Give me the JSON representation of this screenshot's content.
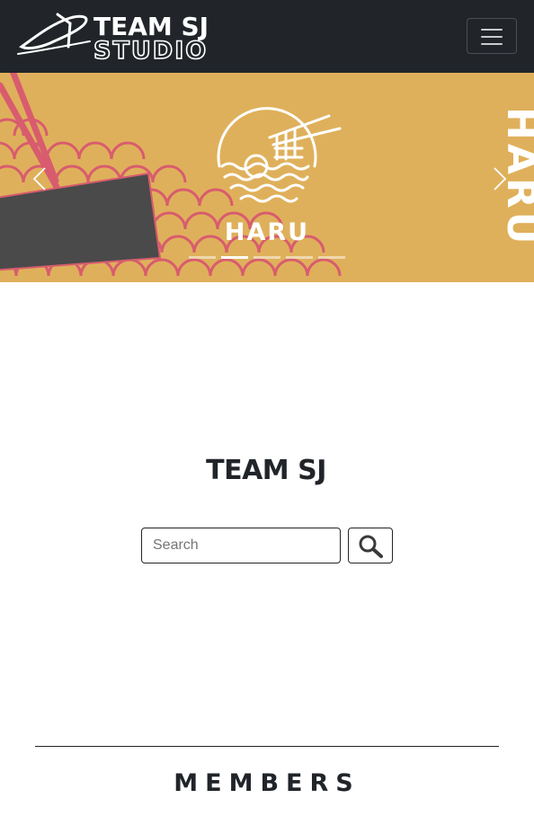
{
  "navbar": {
    "brand_line1": "TEAM SJ",
    "brand_line2": "STUDIO",
    "brand_color": "#ffffff",
    "background": "#212529",
    "menu_icon": "hamburger-icon"
  },
  "carousel": {
    "slide_caption": "HARU",
    "slide_caption_sideways": "HARU",
    "background": "#dfb05b",
    "accent": "#d85c6e",
    "prev_icon": "chevron-left-icon",
    "next_icon": "chevron-right-icon",
    "indicator_count": 5,
    "active_indicator": 2
  },
  "main": {
    "logo_text": "TEAM SJ",
    "search": {
      "placeholder": "Search",
      "value": "",
      "button_icon": "magnifier-icon"
    }
  },
  "members": {
    "title": "MEMBERS"
  }
}
